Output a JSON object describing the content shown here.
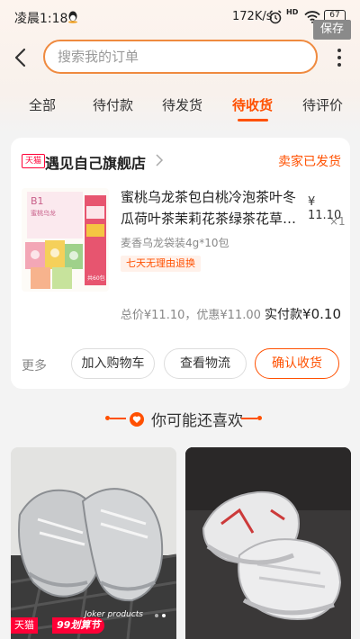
{
  "status_bar": {
    "time": "凌晨1:18",
    "net_speed": "172K/s",
    "hd_label": "HD",
    "battery": "67"
  },
  "overlay": {
    "save_label": "保存"
  },
  "search": {
    "placeholder": "搜索我的订单"
  },
  "tabs": [
    {
      "label": "全部"
    },
    {
      "label": "待付款"
    },
    {
      "label": "待发货"
    },
    {
      "label": "待收货",
      "active": true
    },
    {
      "label": "待评价"
    }
  ],
  "order": {
    "platform_badge": "天猫",
    "store_name": "遇见自己旗舰店",
    "status": "卖家已发货",
    "product": {
      "title": "蜜桃乌龙茶包白桃冷泡茶叶冬瓜荷叶茶茉莉花茶绿茶花草…",
      "price_symbol": "¥",
      "price": "11.10",
      "quantity": "×1",
      "sku": "麦香乌龙袋装4g*10包",
      "return_policy": "七天无理由退换",
      "thumb_label": "B1",
      "thumb_text": "蜜桃乌龙",
      "thumb_badge": "共60包"
    },
    "summary": {
      "total_label": "总价",
      "total_value": "¥11.10",
      "discount_label": "，优惠",
      "discount_value": "¥11.00",
      "actual_label": "实付款",
      "actual_value": "¥0.10"
    },
    "actions": {
      "more": "更多",
      "add_to_cart": "加入购物车",
      "view_logistics": "查看物流",
      "confirm_receipt": "确认收货"
    }
  },
  "recommendations": {
    "title": "你可能还喜欢",
    "items": [
      {
        "tag_tmall": "天猫",
        "tag_promo": "99划算节",
        "brand_mark": "Joker products"
      },
      {}
    ]
  },
  "colors": {
    "accent": "#ff5000",
    "tmall_red": "#ff0036",
    "search_border": "#ef8a3f"
  }
}
